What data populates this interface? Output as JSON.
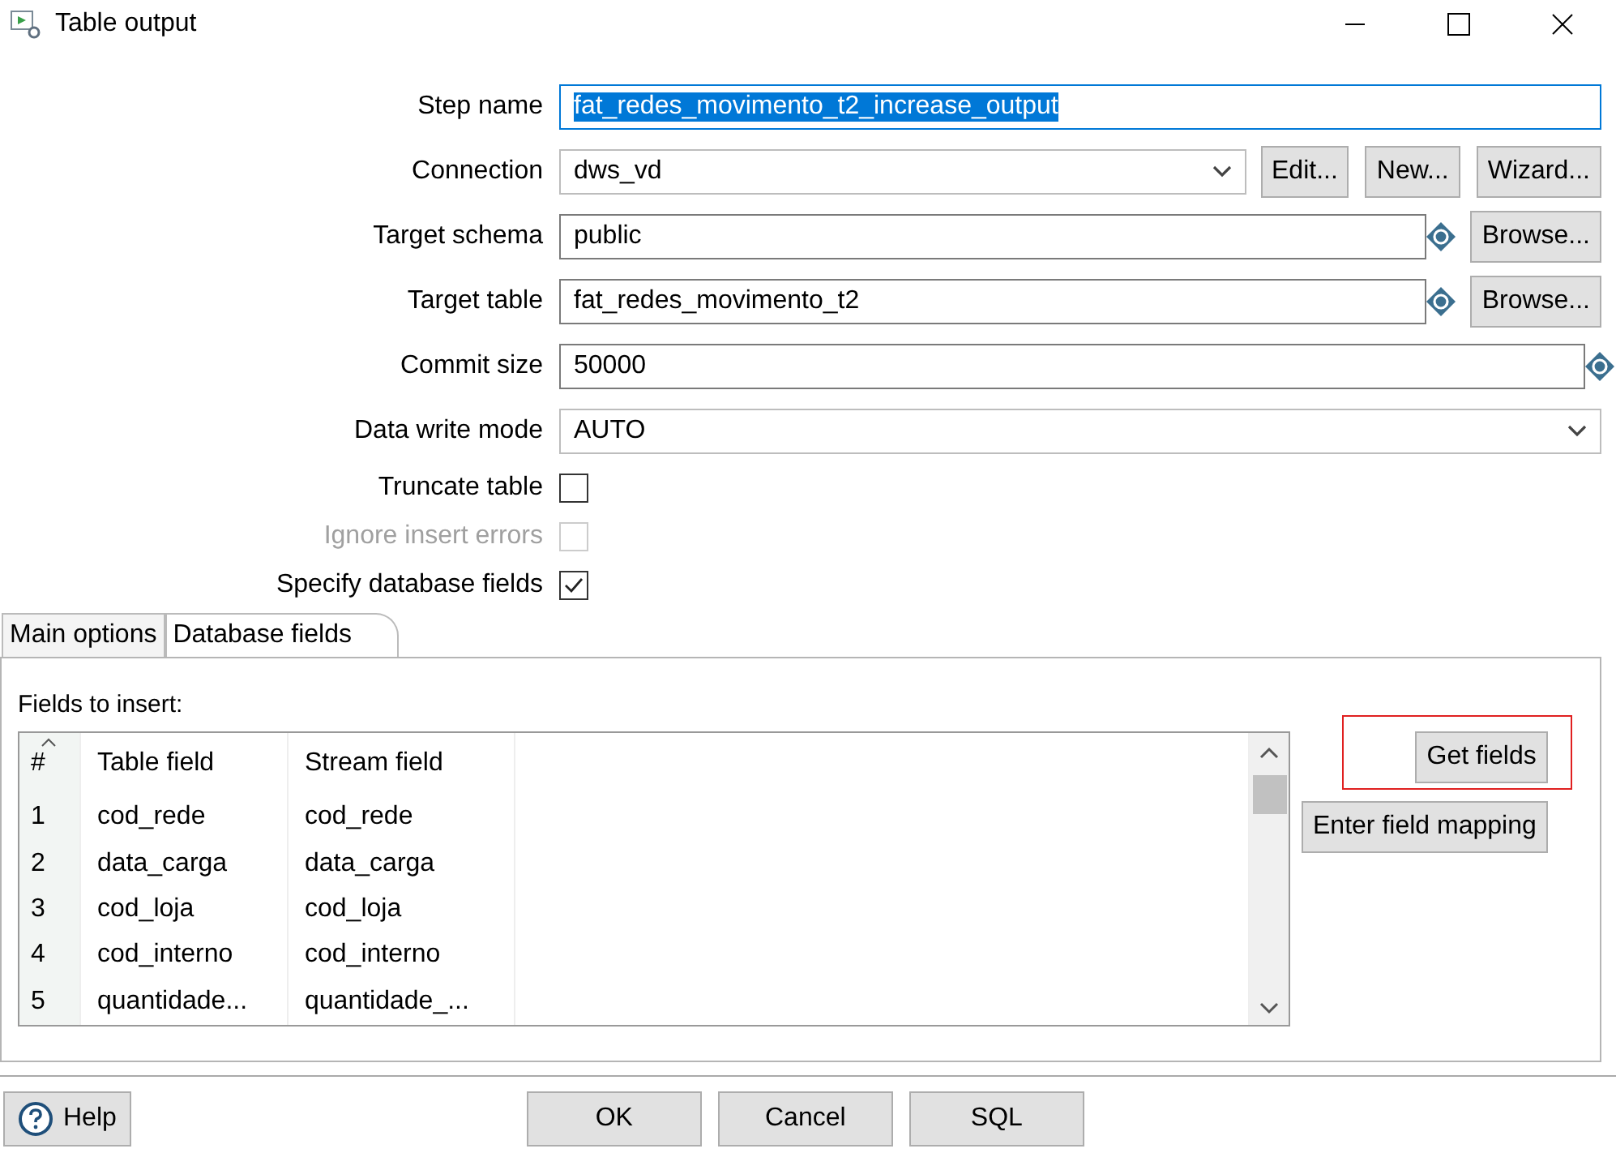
{
  "window": {
    "title": "Table output"
  },
  "fields": [
    {
      "kind": "text",
      "label": "Step name",
      "value": "fat_redes_movimento_t2_increase_output",
      "selected": true,
      "variable": false
    },
    {
      "kind": "combo",
      "label": "Connection",
      "value": "dws_vd",
      "buttons": [
        "Edit...",
        "New...",
        "Wizard..."
      ]
    },
    {
      "kind": "text",
      "label": "Target schema",
      "value": "public",
      "selected": false,
      "variable": true,
      "buttons": [
        "Browse..."
      ]
    },
    {
      "kind": "text",
      "label": "Target table",
      "value": "fat_redes_movimento_t2",
      "selected": false,
      "variable": true,
      "buttons": [
        "Browse..."
      ]
    },
    {
      "kind": "text",
      "label": "Commit size",
      "value": "50000",
      "selected": false,
      "variable": true
    },
    {
      "kind": "combo",
      "label": "Data write mode",
      "value": "AUTO"
    },
    {
      "kind": "checkbox",
      "label": "Truncate table",
      "checked": false,
      "disabled": false
    },
    {
      "kind": "checkbox",
      "label": "Ignore insert errors",
      "checked": false,
      "disabled": true
    },
    {
      "kind": "checkbox",
      "label": "Specify database fields",
      "checked": true,
      "disabled": false
    }
  ],
  "tabs": [
    {
      "label": "Main options",
      "selected": false
    },
    {
      "label": "Database fields",
      "selected": true
    }
  ],
  "fields_label": "Fields to insert:",
  "table": {
    "columns": [
      {
        "label": "#",
        "sorted": true
      },
      {
        "label": "Table field",
        "sorted": false
      },
      {
        "label": "Stream field",
        "sorted": false
      }
    ],
    "rows": [
      [
        "1",
        "cod_rede",
        "cod_rede"
      ],
      [
        "2",
        "data_carga",
        "data_carga"
      ],
      [
        "3",
        "cod_loja",
        "cod_loja"
      ],
      [
        "4",
        "cod_interno",
        "cod_interno"
      ],
      [
        "5",
        "quantidade...",
        "quantidade_..."
      ]
    ]
  },
  "side_buttons": [
    {
      "label": "Get fields",
      "highlighted": true
    },
    {
      "label": "Enter field mapping",
      "highlighted": false
    }
  ],
  "footer": {
    "help": "Help",
    "buttons": [
      "OK",
      "Cancel",
      "SQL"
    ]
  }
}
